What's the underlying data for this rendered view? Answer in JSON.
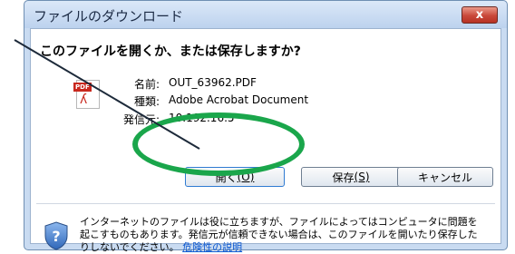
{
  "window": {
    "title": "ファイルのダウンロード",
    "close_icon_text": "x"
  },
  "dialog": {
    "question": "このファイルを開くか、または保存しますか?",
    "file_info": {
      "name_label": "名前:",
      "name_value": "OUT_63962.PDF",
      "type_label": "種類:",
      "type_value": "Adobe Acrobat Document",
      "from_label": "発信元:",
      "from_value": "10.192.16.5"
    },
    "buttons": {
      "open_label": "開く",
      "open_accel": "(O)",
      "save_label": "保存",
      "save_accel": "(S)",
      "cancel_label": "キャンセル"
    },
    "warning": {
      "text": "インターネットのファイルは役に立ちますが、ファイルによってはコンピュータに問題を起こすものもあります。発信元が信頼できない場合は、このファイルを開いたり保存したりしないでください。",
      "link_text": "危険性の説明"
    }
  },
  "icons": [
    "pdf-file-icon",
    "shield-icon",
    "close-icon"
  ],
  "colors": {
    "annotation_green": "#1aa64b",
    "close_red": "#c9483a",
    "link_blue": "#0b57d0"
  }
}
